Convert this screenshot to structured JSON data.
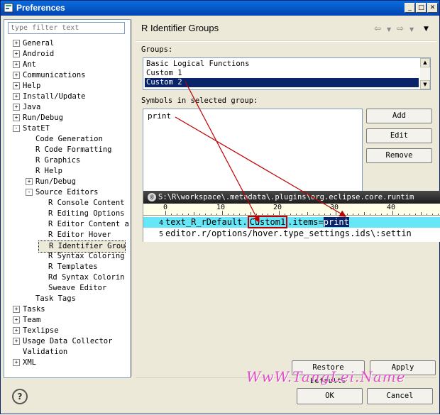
{
  "window": {
    "title": "Preferences"
  },
  "filter": {
    "placeholder": "type filter text"
  },
  "tree": [
    {
      "label": "General",
      "indent": 0,
      "expander": "+"
    },
    {
      "label": "Android",
      "indent": 0,
      "expander": "+"
    },
    {
      "label": "Ant",
      "indent": 0,
      "expander": "+"
    },
    {
      "label": "Communications",
      "indent": 0,
      "expander": "+"
    },
    {
      "label": "Help",
      "indent": 0,
      "expander": "+"
    },
    {
      "label": "Install/Update",
      "indent": 0,
      "expander": "+"
    },
    {
      "label": "Java",
      "indent": 0,
      "expander": "+"
    },
    {
      "label": "Run/Debug",
      "indent": 0,
      "expander": "+"
    },
    {
      "label": "StatET",
      "indent": 0,
      "expander": "-"
    },
    {
      "label": "Code Generation",
      "indent": 1,
      "expander": ""
    },
    {
      "label": "R Code Formatting",
      "indent": 1,
      "expander": ""
    },
    {
      "label": "R Graphics",
      "indent": 1,
      "expander": ""
    },
    {
      "label": "R Help",
      "indent": 1,
      "expander": ""
    },
    {
      "label": "Run/Debug",
      "indent": 1,
      "expander": "+"
    },
    {
      "label": "Source Editors",
      "indent": 1,
      "expander": "-"
    },
    {
      "label": "R Console Content",
      "indent": 2,
      "expander": ""
    },
    {
      "label": "R Editing Options",
      "indent": 2,
      "expander": ""
    },
    {
      "label": "R Editor Content a",
      "indent": 2,
      "expander": ""
    },
    {
      "label": "R Editor Hover",
      "indent": 2,
      "expander": ""
    },
    {
      "label": "R Identifier Grou",
      "indent": 2,
      "expander": "",
      "selected": true
    },
    {
      "label": "R Syntax Coloring",
      "indent": 2,
      "expander": ""
    },
    {
      "label": "R Templates",
      "indent": 2,
      "expander": ""
    },
    {
      "label": "Rd Syntax Colorin",
      "indent": 2,
      "expander": ""
    },
    {
      "label": "Sweave Editor",
      "indent": 2,
      "expander": ""
    },
    {
      "label": "Task Tags",
      "indent": 1,
      "expander": ""
    },
    {
      "label": "Tasks",
      "indent": 0,
      "expander": "+"
    },
    {
      "label": "Team",
      "indent": 0,
      "expander": "+"
    },
    {
      "label": "Texlipse",
      "indent": 0,
      "expander": "+"
    },
    {
      "label": "Usage Data Collector",
      "indent": 0,
      "expander": "+"
    },
    {
      "label": "Validation",
      "indent": 0,
      "expander": ""
    },
    {
      "label": "XML",
      "indent": 0,
      "expander": "+"
    }
  ],
  "page": {
    "title": "R Identifier Groups"
  },
  "groups": {
    "label": "Groups:",
    "items": [
      "Basic Logical Functions",
      "Custom 1",
      "Custom 2"
    ],
    "selected_index": 2
  },
  "symbols": {
    "label": "Symbols in selected group:",
    "items": [
      "print"
    ]
  },
  "buttons": {
    "add": "Add",
    "edit": "Edit",
    "remove": "Remove",
    "restore": "Restore Defaults",
    "apply": "Apply",
    "ok": "OK",
    "cancel": "Cancel"
  },
  "editor": {
    "path": "S:\\R\\workspace\\.metadata\\.plugins\\org.eclipse.core.runtim",
    "ruler_labels": [
      "0",
      "10",
      "20",
      "30",
      "40"
    ],
    "lines": [
      {
        "num": "4",
        "pre": "text_R_rDefault.",
        "hl": "Custom1",
        "mid": ".items=",
        "sel": "print"
      },
      {
        "num": "5",
        "text": "editor.r/options/hover.type_settings.ids\\:settin"
      }
    ]
  },
  "watermark": "WwW.TangLei.Name",
  "help": "?"
}
